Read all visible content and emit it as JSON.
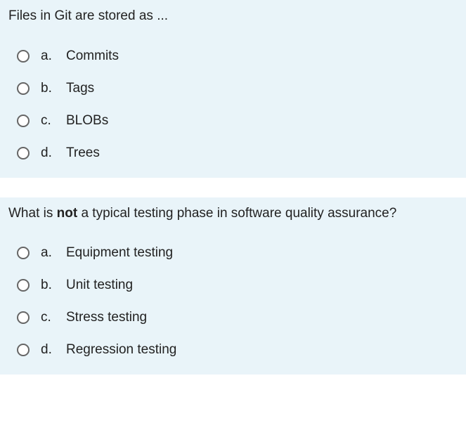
{
  "questions": [
    {
      "prompt_html": "Files in Git are stored as ...",
      "options": [
        {
          "letter": "a.",
          "text": "Commits"
        },
        {
          "letter": "b.",
          "text": "Tags"
        },
        {
          "letter": "c.",
          "text": "BLOBs"
        },
        {
          "letter": "d.",
          "text": "Trees"
        }
      ]
    },
    {
      "prompt_html": "What is <strong>not</strong> a typical testing phase in software quality assurance?",
      "options": [
        {
          "letter": "a.",
          "text": "Equipment testing"
        },
        {
          "letter": "b.",
          "text": "Unit testing"
        },
        {
          "letter": "c.",
          "text": "Stress testing"
        },
        {
          "letter": "d.",
          "text": "Regression testing"
        }
      ]
    }
  ]
}
